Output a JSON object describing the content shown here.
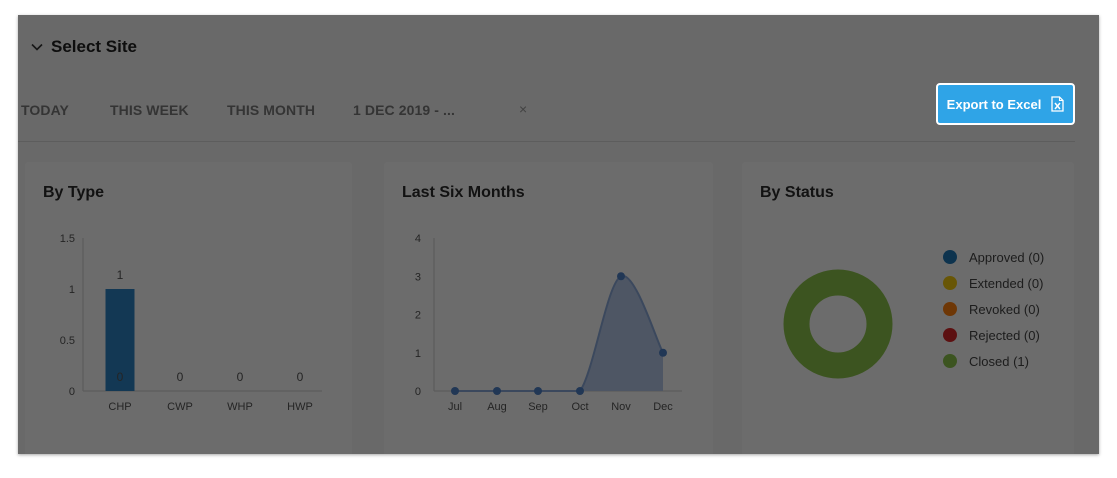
{
  "header": {
    "select_site_label": "Select Site"
  },
  "filters": {
    "tabs": [
      "TODAY",
      "THIS WEEK",
      "THIS MONTH",
      "1 DEC 2019 - ..."
    ],
    "clear_icon": "×"
  },
  "export_button": {
    "label": "Export to Excel",
    "icon": "excel-file-icon"
  },
  "colors": {
    "bar": "#2c82c4",
    "area_fill": "#b5c8e8",
    "line": "#8aa8d8",
    "point": "#4e80c6",
    "donut": "#8bc34a",
    "export_bg": "#2fa4e7"
  },
  "chart_data": [
    {
      "type": "bar",
      "title": "By Type",
      "categories": [
        "CHP",
        "CWP",
        "WHP",
        "HWP"
      ],
      "values": [
        1,
        0,
        0,
        0
      ],
      "data_labels": [
        "1",
        "0",
        "0",
        "0"
      ],
      "yticks": [
        "0",
        "0.5",
        "1",
        "1.5"
      ],
      "ylim": [
        0,
        1.5
      ],
      "grid": false
    },
    {
      "type": "area",
      "title": "Last Six Months",
      "categories": [
        "Jul",
        "Aug",
        "Sep",
        "Oct",
        "Nov",
        "Dec"
      ],
      "values": [
        0,
        0,
        0,
        0,
        3,
        1
      ],
      "yticks": [
        "0",
        "1",
        "2",
        "3",
        "4"
      ],
      "ylim": [
        0,
        4
      ],
      "grid": false
    },
    {
      "type": "pie",
      "title": "By Status",
      "legend_position": "right",
      "slices": [
        {
          "label": "Approved (0)",
          "value": 0,
          "color": "#1f77b4"
        },
        {
          "label": "Extended (0)",
          "value": 0,
          "color": "#f2c70f"
        },
        {
          "label": "Revoked (0)",
          "value": 0,
          "color": "#ff7f0e"
        },
        {
          "label": "Rejected (0)",
          "value": 0,
          "color": "#d62728"
        },
        {
          "label": "Closed (1)",
          "value": 1,
          "color": "#8bc34a"
        }
      ]
    }
  ]
}
